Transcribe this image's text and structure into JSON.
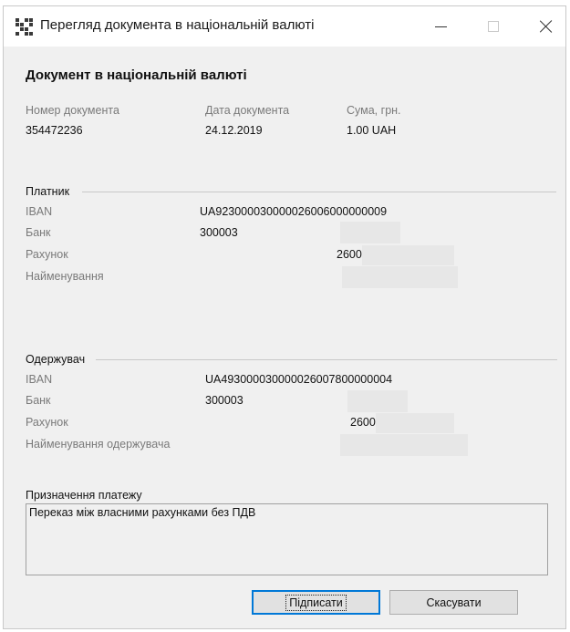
{
  "window": {
    "title": "Перегляд документа в національній валюті",
    "icon": "qr-code-icon"
  },
  "heading": "Документ в національній валюті",
  "summary": {
    "doc_number_label": "Номер документа",
    "doc_number": "354472236",
    "doc_date_label": "Дата документа",
    "doc_date": "24.12.2019",
    "amount_label": "Сума, грн.",
    "amount": "1.00 UAH"
  },
  "payer": {
    "group_label": "Платник",
    "iban_label": "IBAN",
    "iban": "UA923000030000026006000000009",
    "bank_label": "Банк",
    "bank": "300003",
    "account_label": "Рахунок",
    "account": "2600",
    "name_label": "Найменування"
  },
  "receiver": {
    "group_label": "Одержувач",
    "iban_label": "IBAN",
    "iban": "UA493000030000026007800000004",
    "bank_label": "Банк",
    "bank": "300003",
    "account_label": "Рахунок",
    "account": "2600",
    "name_label": "Найменування одержувача"
  },
  "purpose": {
    "label": "Призначення платежу",
    "text": "Переказ між власними рахунками без ПДВ"
  },
  "buttons": {
    "sign": "Підписати",
    "cancel": "Скасувати"
  },
  "colors": {
    "focus_border": "#0078d7",
    "dialog_bg": "#f0f0f0"
  }
}
